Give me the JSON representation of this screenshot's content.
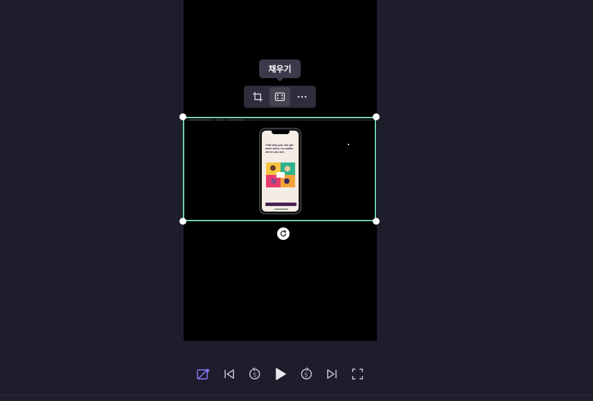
{
  "tooltip": {
    "text": "채우기"
  },
  "toolbar": {
    "buttons": [
      {
        "name": "crop-button",
        "icon": "crop-icon"
      },
      {
        "name": "fill-button",
        "icon": "fill-screen-icon",
        "active": true
      },
      {
        "name": "more-options-button",
        "icon": "more-horizontal-icon"
      }
    ]
  },
  "selection": {
    "accent": "#6fd2b0"
  },
  "phone_preview": {
    "headline": "That way you can get work done, no matter where you are."
  },
  "playback": {
    "buttons": [
      "ai-magic-icon",
      "skip-back-icon",
      "rewind-5-icon",
      "play-icon",
      "forward-5-icon",
      "skip-forward-icon",
      "fullscreen-icon"
    ],
    "rewind_seconds": "5",
    "forward_seconds": "5"
  },
  "colors": {
    "background": "#1e1d2b",
    "stage": "#000000",
    "accent_purple": "#8b7cff"
  }
}
